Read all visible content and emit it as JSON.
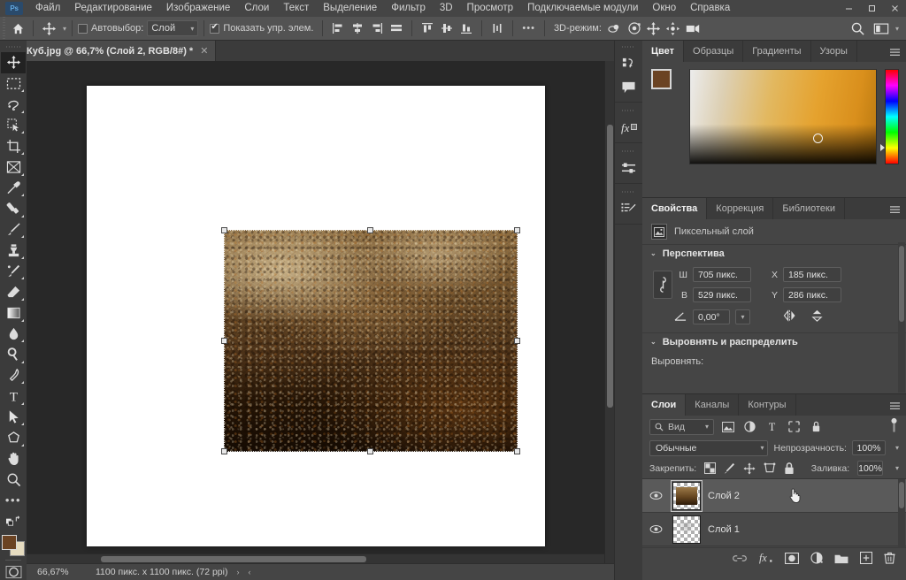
{
  "app": {
    "logo": "Ps",
    "menu": [
      "Файл",
      "Редактирование",
      "Изображение",
      "Слои",
      "Текст",
      "Выделение",
      "Фильтр",
      "3D",
      "Просмотр",
      "Подключаемые модули",
      "Окно",
      "Справка"
    ],
    "window_buttons": [
      "minimize",
      "maximize",
      "close"
    ]
  },
  "options_bar": {
    "home_icon": "home-icon",
    "tool_icon": "move-tool-icon",
    "auto_select_label": "Автовыбор:",
    "auto_select_checked": false,
    "auto_select_value": "Слой",
    "show_controls_label": "Показать упр. элем.",
    "show_controls_checked": true,
    "align_group_1": [
      "align-left-edges",
      "align-horizontal-centers",
      "align-right-edges",
      "align-top-edges"
    ],
    "align_group_2": [
      "distribute-top",
      "distribute-vertical-centers",
      "distribute-bottom",
      "distribute-width"
    ],
    "more_label": "•••",
    "mode_3d_label": "3D-режим:",
    "mode_3d_icons": [
      "orbit-3d-icon",
      "roll-3d-icon",
      "pan-3d-icon",
      "slide-3d-icon",
      "camera-3d-icon"
    ],
    "search_icon": "search-icon",
    "workspace_icon": "workspace-icon"
  },
  "document": {
    "tab_title": "Куб.jpg @ 66,7% (Слой 2, RGB/8#) *",
    "close_icon": "close-icon"
  },
  "toolbar": {
    "tools": [
      {
        "name": "move-tool",
        "glyph": "move",
        "active": true
      },
      {
        "name": "rectangular-marquee-tool",
        "glyph": "marquee",
        "active": false
      },
      {
        "name": "lasso-tool",
        "glyph": "lasso",
        "active": false
      },
      {
        "name": "object-selection-tool",
        "glyph": "quickselect",
        "active": false
      },
      {
        "name": "crop-tool",
        "glyph": "crop",
        "active": false
      },
      {
        "name": "frame-tool",
        "glyph": "frame",
        "active": false
      },
      {
        "name": "eyedropper-tool",
        "glyph": "eyedropper",
        "active": false
      },
      {
        "name": "spot-healing-brush-tool",
        "glyph": "healing",
        "active": false
      },
      {
        "name": "brush-tool",
        "glyph": "brush",
        "active": false
      },
      {
        "name": "clone-stamp-tool",
        "glyph": "stamp",
        "active": false
      },
      {
        "name": "history-brush-tool",
        "glyph": "historybrush",
        "active": false
      },
      {
        "name": "eraser-tool",
        "glyph": "eraser",
        "active": false
      },
      {
        "name": "gradient-tool",
        "glyph": "gradient",
        "active": false
      },
      {
        "name": "blur-tool",
        "glyph": "blur",
        "active": false
      },
      {
        "name": "dodge-tool",
        "glyph": "dodge",
        "active": false
      },
      {
        "name": "pen-tool",
        "glyph": "pen",
        "active": false
      },
      {
        "name": "type-tool",
        "glyph": "type",
        "active": false
      },
      {
        "name": "path-selection-tool",
        "glyph": "pathselect",
        "active": false
      },
      {
        "name": "shape-tool",
        "glyph": "polygon",
        "active": false
      },
      {
        "name": "hand-tool",
        "glyph": "hand",
        "active": false
      },
      {
        "name": "zoom-tool",
        "glyph": "zoom",
        "active": false
      }
    ],
    "edit_toolbar_label": "•••",
    "foreground_color": "#6b4323",
    "background_color": "#e6dcc0",
    "quick_mask_icon": "quick-mask-icon"
  },
  "status_bar": {
    "zoom": "66,67%",
    "info": "1100 пикс. x 1100 пикс. (72 ppi)",
    "arrow": "›"
  },
  "rail": {
    "groups": [
      [
        "history-icon",
        "notes-icon"
      ],
      [
        "fx-styles-icon"
      ],
      [
        "adjustments-icon"
      ],
      [
        "brush-settings-icon"
      ]
    ]
  },
  "color_panel": {
    "tabs": [
      {
        "label": "Цвет",
        "active": true
      },
      {
        "label": "Образцы",
        "active": false
      },
      {
        "label": "Градиенты",
        "active": false
      },
      {
        "label": "Узоры",
        "active": false
      }
    ],
    "menu_icon": "panel-menu-icon",
    "foreground": "#6b4323",
    "background": "#e8dec2",
    "picker_icon": "color-ring-cursor",
    "hue_slider_icon": "hue-slider"
  },
  "properties_panel": {
    "tabs": [
      {
        "label": "Свойства",
        "active": true
      },
      {
        "label": "Коррекция",
        "active": false
      },
      {
        "label": "Библиотеки",
        "active": false
      }
    ],
    "menu_icon": "panel-menu-icon",
    "layer_type_label": "Пиксельный слой",
    "layer_type_icon": "pixel-layer-icon",
    "transform_section": {
      "title": "Перспектива",
      "width_label": "Ш",
      "width_value": "705 пикс.",
      "height_label": "В",
      "height_value": "529 пикс.",
      "x_label": "X",
      "x_value": "185 пикс.",
      "y_label": "Y",
      "y_value": "286 пикс.",
      "angle_label": "angle-icon",
      "angle_value": "0,00°",
      "flip_h_icon": "flip-horizontal-icon",
      "flip_v_icon": "flip-vertical-icon",
      "link_icon": "link-dimensions-icon"
    },
    "align_section": {
      "title": "Выровнять и распределить",
      "align_label": "Выровнять:"
    }
  },
  "layers_panel": {
    "tabs": [
      {
        "label": "Слои",
        "active": true
      },
      {
        "label": "Каналы",
        "active": false
      },
      {
        "label": "Контуры",
        "active": false
      }
    ],
    "menu_icon": "panel-menu-icon",
    "filter_placeholder": "Вид",
    "filter_search_icon": "search-icon",
    "filter_icons": [
      "filter-pixel-icon",
      "filter-adjustment-icon",
      "filter-type-icon",
      "filter-shape-icon",
      "filter-smart-icon"
    ],
    "filter_toggle_icon": "filter-toggle-icon",
    "blend_mode": "Обычные",
    "opacity_label": "Непрозрачность:",
    "opacity_value": "100%",
    "lock_label": "Закрепить:",
    "lock_icons": [
      "lock-transparent-pixels-icon",
      "lock-image-pixels-icon",
      "lock-position-icon",
      "lock-artboard-icon",
      "lock-all-icon"
    ],
    "fill_label": "Заливка:",
    "fill_value": "100%",
    "layers": [
      {
        "name": "Слой 2",
        "visible": true,
        "selected": true,
        "thumb": "image"
      },
      {
        "name": "Слой 1",
        "visible": true,
        "selected": false,
        "thumb": "transparent"
      }
    ],
    "footer_icons": [
      "link-layers-icon",
      "layer-style-fx-icon",
      "add-layer-mask-icon",
      "new-adjustment-layer-icon",
      "new-group-icon",
      "new-layer-icon",
      "delete-layer-icon"
    ]
  },
  "canvas": {
    "document_background": "#ffffff",
    "selection_handles": 8,
    "cursor_icon": "pointing-hand-cursor"
  }
}
